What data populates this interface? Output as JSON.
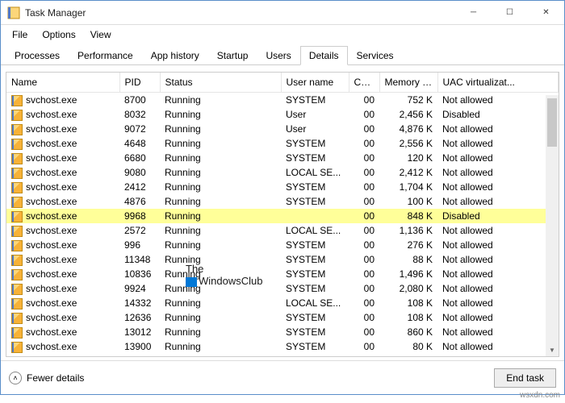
{
  "window": {
    "title": "Task Manager"
  },
  "menu": {
    "file": "File",
    "options": "Options",
    "view": "View"
  },
  "tabs": {
    "processes": "Processes",
    "performance": "Performance",
    "apphistory": "App history",
    "startup": "Startup",
    "users": "Users",
    "details": "Details",
    "services": "Services",
    "active": "details"
  },
  "columns": {
    "name": "Name",
    "pid": "PID",
    "status": "Status",
    "user": "User name",
    "cpu": "CPU",
    "memory": "Memory (a...",
    "uac": "UAC virtualizat..."
  },
  "rows": [
    {
      "name": "svchost.exe",
      "pid": "8700",
      "status": "Running",
      "user": "SYSTEM",
      "cpu": "00",
      "mem": "752 K",
      "uac": "Not allowed",
      "hl": false
    },
    {
      "name": "svchost.exe",
      "pid": "8032",
      "status": "Running",
      "user": "User",
      "cpu": "00",
      "mem": "2,456 K",
      "uac": "Disabled",
      "hl": false
    },
    {
      "name": "svchost.exe",
      "pid": "9072",
      "status": "Running",
      "user": "User",
      "cpu": "00",
      "mem": "4,876 K",
      "uac": "Not allowed",
      "hl": false
    },
    {
      "name": "svchost.exe",
      "pid": "4648",
      "status": "Running",
      "user": "SYSTEM",
      "cpu": "00",
      "mem": "2,556 K",
      "uac": "Not allowed",
      "hl": false
    },
    {
      "name": "svchost.exe",
      "pid": "6680",
      "status": "Running",
      "user": "SYSTEM",
      "cpu": "00",
      "mem": "120 K",
      "uac": "Not allowed",
      "hl": false
    },
    {
      "name": "svchost.exe",
      "pid": "9080",
      "status": "Running",
      "user": "LOCAL SE...",
      "cpu": "00",
      "mem": "2,412 K",
      "uac": "Not allowed",
      "hl": false
    },
    {
      "name": "svchost.exe",
      "pid": "2412",
      "status": "Running",
      "user": "SYSTEM",
      "cpu": "00",
      "mem": "1,704 K",
      "uac": "Not allowed",
      "hl": false
    },
    {
      "name": "svchost.exe",
      "pid": "4876",
      "status": "Running",
      "user": "SYSTEM",
      "cpu": "00",
      "mem": "100 K",
      "uac": "Not allowed",
      "hl": false
    },
    {
      "name": "svchost.exe",
      "pid": "9968",
      "status": "Running",
      "user": "",
      "cpu": "00",
      "mem": "848 K",
      "uac": "Disabled",
      "hl": true
    },
    {
      "name": "svchost.exe",
      "pid": "2572",
      "status": "Running",
      "user": "LOCAL SE...",
      "cpu": "00",
      "mem": "1,136 K",
      "uac": "Not allowed",
      "hl": false
    },
    {
      "name": "svchost.exe",
      "pid": "996",
      "status": "Running",
      "user": "SYSTEM",
      "cpu": "00",
      "mem": "276 K",
      "uac": "Not allowed",
      "hl": false
    },
    {
      "name": "svchost.exe",
      "pid": "11348",
      "status": "Running",
      "user": "SYSTEM",
      "cpu": "00",
      "mem": "88 K",
      "uac": "Not allowed",
      "hl": false
    },
    {
      "name": "svchost.exe",
      "pid": "10836",
      "status": "Running",
      "user": "SYSTEM",
      "cpu": "00",
      "mem": "1,496 K",
      "uac": "Not allowed",
      "hl": false
    },
    {
      "name": "svchost.exe",
      "pid": "9924",
      "status": "Running",
      "user": "SYSTEM",
      "cpu": "00",
      "mem": "2,080 K",
      "uac": "Not allowed",
      "hl": false
    },
    {
      "name": "svchost.exe",
      "pid": "14332",
      "status": "Running",
      "user": "LOCAL SE...",
      "cpu": "00",
      "mem": "108 K",
      "uac": "Not allowed",
      "hl": false
    },
    {
      "name": "svchost.exe",
      "pid": "12636",
      "status": "Running",
      "user": "SYSTEM",
      "cpu": "00",
      "mem": "108 K",
      "uac": "Not allowed",
      "hl": false
    },
    {
      "name": "svchost.exe",
      "pid": "13012",
      "status": "Running",
      "user": "SYSTEM",
      "cpu": "00",
      "mem": "860 K",
      "uac": "Not allowed",
      "hl": false
    },
    {
      "name": "svchost.exe",
      "pid": "13900",
      "status": "Running",
      "user": "SYSTEM",
      "cpu": "00",
      "mem": "80 K",
      "uac": "Not allowed",
      "hl": false
    }
  ],
  "footer": {
    "fewer": "Fewer details",
    "endtask": "End task"
  },
  "watermark": {
    "line1": "The",
    "line2": "WindowsClub",
    "url": "wsxdn.com"
  }
}
